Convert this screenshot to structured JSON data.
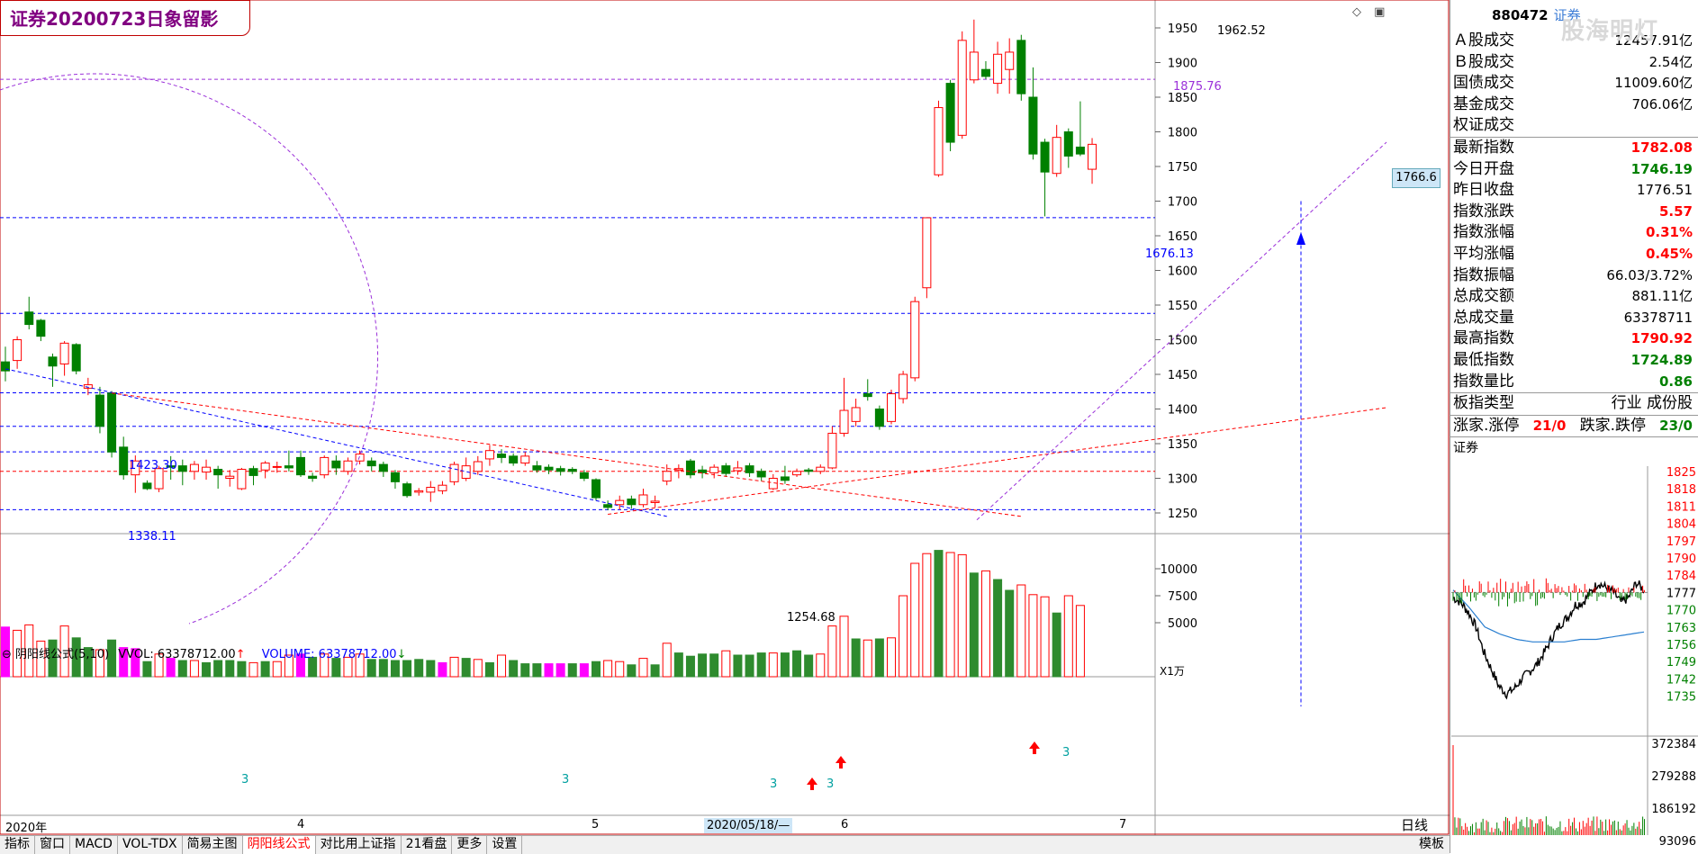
{
  "title": "证券20200723日象留影",
  "watermark": "股海明灯",
  "indicator": {
    "name": "阴阳线公式(5,10)",
    "vvol_label": "VVOL: 63378712.00",
    "vvol_arrow": "↑",
    "volume_label": "VOLUME: 63378712.00",
    "volume_arrow": "↓"
  },
  "top_icons": [
    "◇",
    "▣"
  ],
  "price_axis": [
    "1950",
    "1900",
    "1850",
    "1800",
    "1750",
    "1700",
    "1650",
    "1600",
    "1550",
    "1500",
    "1450",
    "1400",
    "1350",
    "1300",
    "1250"
  ],
  "volume_axis": [
    "10000",
    "7500",
    "5000"
  ],
  "volume_unit": "X1万",
  "price_tag": "1766.6",
  "annotations": {
    "high": "1962.52",
    "h2": "1875.76",
    "l1676": "1676.13",
    "l1423": "1423.30",
    "l1338": "1338.11",
    "low": "1254.68"
  },
  "x_labels": {
    "y2020": "2020年",
    "m4": "4",
    "m5": "5",
    "date_box": "2020/05/18/—",
    "m6": "6",
    "m7": "7"
  },
  "day_label": "日线",
  "tabs": [
    "指标",
    "窗口",
    "MACD",
    "VOL-TDX",
    "简易主图",
    "阴阳线公式",
    "对比用上证指",
    "21看盘",
    "更多",
    "设置"
  ],
  "active_tab": "阴阳线公式",
  "tab_right": "模板",
  "panel": {
    "code": "880472",
    "name": "证券",
    "rows1": [
      {
        "l": "Ａ股成交",
        "v": "12457.91亿",
        "c": "black"
      },
      {
        "l": "Ｂ股成交",
        "v": "2.54亿",
        "c": "black"
      },
      {
        "l": "国债成交",
        "v": "11009.60亿",
        "c": "black"
      },
      {
        "l": "基金成交",
        "v": "706.06亿",
        "c": "black"
      },
      {
        "l": "权证成交",
        "v": "",
        "c": "black"
      }
    ],
    "rows2": [
      {
        "l": "最新指数",
        "v": "1782.08",
        "c": "red"
      },
      {
        "l": "今日开盘",
        "v": "1746.19",
        "c": "green"
      },
      {
        "l": "昨日收盘",
        "v": "1776.51",
        "c": "black"
      },
      {
        "l": "指数涨跌",
        "v": "5.57",
        "c": "red"
      },
      {
        "l": "指数涨幅",
        "v": "0.31%",
        "c": "red"
      },
      {
        "l": "平均涨幅",
        "v": "0.45%",
        "c": "red"
      },
      {
        "l": "指数振幅",
        "v": "66.03/3.72%",
        "c": "black"
      },
      {
        "l": "总成交额",
        "v": "881.11亿",
        "c": "black"
      },
      {
        "l": "总成交量",
        "v": "63378711",
        "c": "black"
      },
      {
        "l": "最高指数",
        "v": "1790.92",
        "c": "red"
      },
      {
        "l": "最低指数",
        "v": "1724.89",
        "c": "green"
      },
      {
        "l": "指数量比",
        "v": "0.86",
        "c": "green"
      }
    ],
    "type_label": "板指类型",
    "type_value": "行业 成份股",
    "up_label": "涨家.涨停",
    "up_value": "21/0",
    "down_label": "跌家.跌停",
    "down_value": "23/0",
    "mini_title": "证券",
    "mini_axis": [
      "1825",
      "1818",
      "1811",
      "1804",
      "1797",
      "1790",
      "1784",
      "1777",
      "1770",
      "1763",
      "1756",
      "1749",
      "1742",
      "1735"
    ],
    "mini_vol_axis": [
      "372384",
      "279288",
      "186192",
      "93096"
    ]
  },
  "chart_data": {
    "type": "candlestick",
    "y_range": [
      1225,
      1975
    ],
    "volume_range": [
      0,
      13500
    ],
    "candles": [
      {
        "o": 1468,
        "c": 1455,
        "h": 1490,
        "l": 1440
      },
      {
        "o": 1470,
        "c": 1500,
        "h": 1505,
        "l": 1458
      },
      {
        "o": 1540,
        "c": 1522,
        "h": 1562,
        "l": 1515
      },
      {
        "o": 1528,
        "c": 1505,
        "h": 1530,
        "l": 1498
      },
      {
        "o": 1475,
        "c": 1462,
        "h": 1480,
        "l": 1432
      },
      {
        "o": 1465,
        "c": 1495,
        "h": 1498,
        "l": 1448
      },
      {
        "o": 1493,
        "c": 1455,
        "h": 1495,
        "l": 1450
      },
      {
        "o": 1430,
        "c": 1435,
        "h": 1445,
        "l": 1420
      },
      {
        "o": 1420,
        "c": 1375,
        "h": 1432,
        "l": 1365
      },
      {
        "o": 1423,
        "c": 1338,
        "h": 1426,
        "l": 1330
      },
      {
        "o": 1345,
        "c": 1305,
        "h": 1360,
        "l": 1298
      },
      {
        "o": 1305,
        "c": 1325,
        "h": 1333,
        "l": 1279
      },
      {
        "o": 1293,
        "c": 1285,
        "h": 1297,
        "l": 1283
      },
      {
        "o": 1285,
        "c": 1314,
        "h": 1318,
        "l": 1280
      },
      {
        "o": 1318,
        "c": 1316,
        "h": 1332,
        "l": 1298
      },
      {
        "o": 1318,
        "c": 1310,
        "h": 1327,
        "l": 1290
      },
      {
        "o": 1310,
        "c": 1320,
        "h": 1325,
        "l": 1298
      },
      {
        "o": 1309,
        "c": 1316,
        "h": 1327,
        "l": 1298
      },
      {
        "o": 1313,
        "c": 1305,
        "h": 1318,
        "l": 1285
      },
      {
        "o": 1300,
        "c": 1303,
        "h": 1312,
        "l": 1288
      },
      {
        "o": 1285,
        "c": 1313,
        "h": 1315,
        "l": 1283
      },
      {
        "o": 1314,
        "c": 1304,
        "h": 1318,
        "l": 1290
      },
      {
        "o": 1312,
        "c": 1322,
        "h": 1325,
        "l": 1300
      },
      {
        "o": 1316,
        "c": 1317,
        "h": 1324,
        "l": 1308
      },
      {
        "o": 1318,
        "c": 1315,
        "h": 1340,
        "l": 1310
      },
      {
        "o": 1330,
        "c": 1305,
        "h": 1340,
        "l": 1302
      },
      {
        "o": 1303,
        "c": 1300,
        "h": 1308,
        "l": 1295
      },
      {
        "o": 1305,
        "c": 1330,
        "h": 1333,
        "l": 1300
      },
      {
        "o": 1325,
        "c": 1315,
        "h": 1333,
        "l": 1305
      },
      {
        "o": 1310,
        "c": 1325,
        "h": 1330,
        "l": 1305
      },
      {
        "o": 1325,
        "c": 1335,
        "h": 1340,
        "l": 1320
      },
      {
        "o": 1325,
        "c": 1318,
        "h": 1330,
        "l": 1310
      },
      {
        "o": 1320,
        "c": 1310,
        "h": 1324,
        "l": 1302
      },
      {
        "o": 1308,
        "c": 1295,
        "h": 1312,
        "l": 1285
      },
      {
        "o": 1292,
        "c": 1275,
        "h": 1295,
        "l": 1272
      },
      {
        "o": 1280,
        "c": 1282,
        "h": 1286,
        "l": 1275
      },
      {
        "o": 1280,
        "c": 1287,
        "h": 1296,
        "l": 1266
      },
      {
        "o": 1282,
        "c": 1290,
        "h": 1296,
        "l": 1277
      },
      {
        "o": 1295,
        "c": 1320,
        "h": 1324,
        "l": 1290
      },
      {
        "o": 1300,
        "c": 1318,
        "h": 1330,
        "l": 1296
      },
      {
        "o": 1310,
        "c": 1324,
        "h": 1332,
        "l": 1305
      },
      {
        "o": 1328,
        "c": 1340,
        "h": 1348,
        "l": 1318
      },
      {
        "o": 1335,
        "c": 1330,
        "h": 1342,
        "l": 1322
      },
      {
        "o": 1332,
        "c": 1322,
        "h": 1336,
        "l": 1318
      },
      {
        "o": 1322,
        "c": 1332,
        "h": 1338,
        "l": 1318
      },
      {
        "o": 1318,
        "c": 1312,
        "h": 1325,
        "l": 1308
      },
      {
        "o": 1316,
        "c": 1312,
        "h": 1320,
        "l": 1306
      },
      {
        "o": 1314,
        "c": 1310,
        "h": 1318,
        "l": 1304
      },
      {
        "o": 1313,
        "c": 1310,
        "h": 1316,
        "l": 1306
      },
      {
        "o": 1308,
        "c": 1300,
        "h": 1312,
        "l": 1296
      },
      {
        "o": 1298,
        "c": 1272,
        "h": 1300,
        "l": 1268
      },
      {
        "o": 1262,
        "c": 1258,
        "h": 1268,
        "l": 1254
      },
      {
        "o": 1262,
        "c": 1268,
        "h": 1275,
        "l": 1255
      },
      {
        "o": 1270,
        "c": 1262,
        "h": 1275,
        "l": 1256
      },
      {
        "o": 1262,
        "c": 1276,
        "h": 1285,
        "l": 1258
      },
      {
        "o": 1265,
        "c": 1267,
        "h": 1275,
        "l": 1258
      },
      {
        "o": 1296,
        "c": 1310,
        "h": 1320,
        "l": 1290
      },
      {
        "o": 1312,
        "c": 1314,
        "h": 1320,
        "l": 1300
      },
      {
        "o": 1325,
        "c": 1305,
        "h": 1328,
        "l": 1300
      },
      {
        "o": 1312,
        "c": 1308,
        "h": 1318,
        "l": 1300
      },
      {
        "o": 1308,
        "c": 1316,
        "h": 1320,
        "l": 1300
      },
      {
        "o": 1318,
        "c": 1307,
        "h": 1322,
        "l": 1302
      },
      {
        "o": 1311,
        "c": 1315,
        "h": 1325,
        "l": 1305
      },
      {
        "o": 1318,
        "c": 1308,
        "h": 1322,
        "l": 1302
      },
      {
        "o": 1310,
        "c": 1302,
        "h": 1314,
        "l": 1296
      },
      {
        "o": 1285,
        "c": 1300,
        "h": 1306,
        "l": 1283
      },
      {
        "o": 1302,
        "c": 1297,
        "h": 1318,
        "l": 1292
      },
      {
        "o": 1305,
        "c": 1310,
        "h": 1314,
        "l": 1302
      },
      {
        "o": 1312,
        "c": 1310,
        "h": 1315,
        "l": 1305
      },
      {
        "o": 1310,
        "c": 1316,
        "h": 1320,
        "l": 1306
      },
      {
        "o": 1315,
        "c": 1365,
        "h": 1375,
        "l": 1313
      },
      {
        "o": 1365,
        "c": 1398,
        "h": 1445,
        "l": 1360
      },
      {
        "o": 1382,
        "c": 1402,
        "h": 1415,
        "l": 1375
      },
      {
        "o": 1422,
        "c": 1418,
        "h": 1443,
        "l": 1412
      },
      {
        "o": 1400,
        "c": 1375,
        "h": 1405,
        "l": 1370
      },
      {
        "o": 1382,
        "c": 1422,
        "h": 1428,
        "l": 1378
      },
      {
        "o": 1415,
        "c": 1450,
        "h": 1455,
        "l": 1408
      },
      {
        "o": 1445,
        "c": 1555,
        "h": 1562,
        "l": 1440
      },
      {
        "o": 1575,
        "c": 1676,
        "h": 1676,
        "l": 1560
      },
      {
        "o": 1738,
        "c": 1835,
        "h": 1845,
        "l": 1735
      },
      {
        "o": 1870,
        "c": 1785,
        "h": 1875,
        "l": 1772
      },
      {
        "o": 1795,
        "c": 1932,
        "h": 1945,
        "l": 1790
      },
      {
        "o": 1875,
        "c": 1915,
        "h": 1962,
        "l": 1870
      },
      {
        "o": 1890,
        "c": 1880,
        "h": 1902,
        "l": 1876
      },
      {
        "o": 1870,
        "c": 1912,
        "h": 1930,
        "l": 1855
      },
      {
        "o": 1890,
        "c": 1915,
        "h": 1935,
        "l": 1855
      },
      {
        "o": 1932,
        "c": 1855,
        "h": 1940,
        "l": 1845
      },
      {
        "o": 1850,
        "c": 1768,
        "h": 1893,
        "l": 1760
      },
      {
        "o": 1785,
        "c": 1742,
        "h": 1790,
        "l": 1678
      },
      {
        "o": 1740,
        "c": 1792,
        "h": 1810,
        "l": 1735
      },
      {
        "o": 1800,
        "c": 1765,
        "h": 1805,
        "l": 1748
      },
      {
        "o": 1778,
        "c": 1768,
        "h": 1844,
        "l": 1765
      },
      {
        "o": 1746,
        "c": 1782,
        "h": 1791,
        "l": 1725
      }
    ],
    "volumes": [
      {
        "v": 4600,
        "t": "m"
      },
      {
        "v": 4300,
        "t": "r"
      },
      {
        "v": 4800,
        "t": "r"
      },
      {
        "v": 3300,
        "t": "r"
      },
      {
        "v": 3400,
        "t": "g"
      },
      {
        "v": 4700,
        "t": "r"
      },
      {
        "v": 3600,
        "t": "g"
      },
      {
        "v": 2700,
        "t": "g"
      },
      {
        "v": 2500,
        "t": "r"
      },
      {
        "v": 3400,
        "t": "g"
      },
      {
        "v": 2700,
        "t": "m"
      },
      {
        "v": 2600,
        "t": "m"
      },
      {
        "v": 1400,
        "t": "g"
      },
      {
        "v": 2100,
        "t": "r"
      },
      {
        "v": 1700,
        "t": "m"
      },
      {
        "v": 1500,
        "t": "g"
      },
      {
        "v": 1500,
        "t": "r"
      },
      {
        "v": 1300,
        "t": "g"
      },
      {
        "v": 1500,
        "t": "g"
      },
      {
        "v": 1500,
        "t": "g"
      },
      {
        "v": 1400,
        "t": "g"
      },
      {
        "v": 1300,
        "t": "r"
      },
      {
        "v": 1400,
        "t": "g"
      },
      {
        "v": 1400,
        "t": "r"
      },
      {
        "v": 2000,
        "t": "r"
      },
      {
        "v": 2100,
        "t": "m"
      },
      {
        "v": 1800,
        "t": "g"
      },
      {
        "v": 2100,
        "t": "r"
      },
      {
        "v": 1700,
        "t": "g"
      },
      {
        "v": 1800,
        "t": "r"
      },
      {
        "v": 2100,
        "t": "r"
      },
      {
        "v": 1600,
        "t": "g"
      },
      {
        "v": 1600,
        "t": "g"
      },
      {
        "v": 1500,
        "t": "g"
      },
      {
        "v": 1500,
        "t": "g"
      },
      {
        "v": 1600,
        "t": "g"
      },
      {
        "v": 1500,
        "t": "g"
      },
      {
        "v": 1300,
        "t": "m"
      },
      {
        "v": 1800,
        "t": "r"
      },
      {
        "v": 1700,
        "t": "g"
      },
      {
        "v": 1600,
        "t": "r"
      },
      {
        "v": 1300,
        "t": "g"
      },
      {
        "v": 2000,
        "t": "r"
      },
      {
        "v": 1500,
        "t": "g"
      },
      {
        "v": 1200,
        "t": "g"
      },
      {
        "v": 1200,
        "t": "g"
      },
      {
        "v": 1200,
        "t": "m"
      },
      {
        "v": 1200,
        "t": "m"
      },
      {
        "v": 1200,
        "t": "g"
      },
      {
        "v": 1200,
        "t": "m"
      },
      {
        "v": 1400,
        "t": "g"
      },
      {
        "v": 1500,
        "t": "r"
      },
      {
        "v": 1400,
        "t": "r"
      },
      {
        "v": 1100,
        "t": "g"
      },
      {
        "v": 1700,
        "t": "r"
      },
      {
        "v": 1100,
        "t": "g"
      },
      {
        "v": 3100,
        "t": "r"
      },
      {
        "v": 2200,
        "t": "g"
      },
      {
        "v": 1900,
        "t": "g"
      },
      {
        "v": 2100,
        "t": "g"
      },
      {
        "v": 2100,
        "t": "g"
      },
      {
        "v": 2400,
        "t": "r"
      },
      {
        "v": 2000,
        "t": "g"
      },
      {
        "v": 2000,
        "t": "g"
      },
      {
        "v": 2200,
        "t": "g"
      },
      {
        "v": 2200,
        "t": "r"
      },
      {
        "v": 2200,
        "t": "g"
      },
      {
        "v": 2400,
        "t": "g"
      },
      {
        "v": 2000,
        "t": "g"
      },
      {
        "v": 2100,
        "t": "r"
      },
      {
        "v": 4700,
        "t": "r"
      },
      {
        "v": 5600,
        "t": "r"
      },
      {
        "v": 3500,
        "t": "g"
      },
      {
        "v": 3400,
        "t": "r"
      },
      {
        "v": 3500,
        "t": "g"
      },
      {
        "v": 3600,
        "t": "r"
      },
      {
        "v": 7500,
        "t": "r"
      },
      {
        "v": 10500,
        "t": "r"
      },
      {
        "v": 11400,
        "t": "r"
      },
      {
        "v": 11700,
        "t": "g"
      },
      {
        "v": 11500,
        "t": "r"
      },
      {
        "v": 11300,
        "t": "r"
      },
      {
        "v": 9600,
        "t": "g"
      },
      {
        "v": 9800,
        "t": "r"
      },
      {
        "v": 9000,
        "t": "g"
      },
      {
        "v": 8000,
        "t": "g"
      },
      {
        "v": 8500,
        "t": "r"
      },
      {
        "v": 7600,
        "t": "r"
      },
      {
        "v": 7400,
        "t": "r"
      },
      {
        "v": 5900,
        "t": "g"
      },
      {
        "v": 7500,
        "t": "r"
      },
      {
        "v": 6600,
        "t": "r"
      }
    ]
  }
}
